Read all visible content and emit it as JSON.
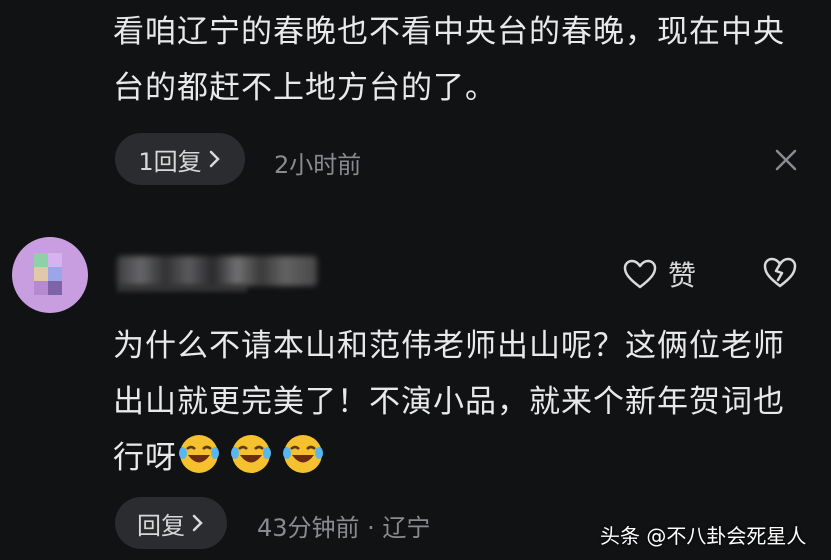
{
  "comment1": {
    "text": "看咱辽宁的春晚也不看中央台的春晚，现在中央台的都赶不上地方台的了。",
    "reply_label": "1回复",
    "time": "2小时前"
  },
  "comment2": {
    "like_label": "赞",
    "text": "为什么不请本山和范伟老师出山呢？这俩位老师出山就更完美了！不演小品，就来个新年贺词也行呀",
    "reply_label": "回复",
    "meta": "43分钟前 · 辽宁"
  },
  "watermark": "头条 @不八卦会死星人",
  "colors": {
    "background": "#111214",
    "pill": "#2b2c2f",
    "muted": "#8a8b8f",
    "avatar": "#c89ee0"
  },
  "icons": [
    "chevron-right-icon",
    "close-icon",
    "heart-icon",
    "broken-heart-icon",
    "laughing-emoji-icon"
  ]
}
